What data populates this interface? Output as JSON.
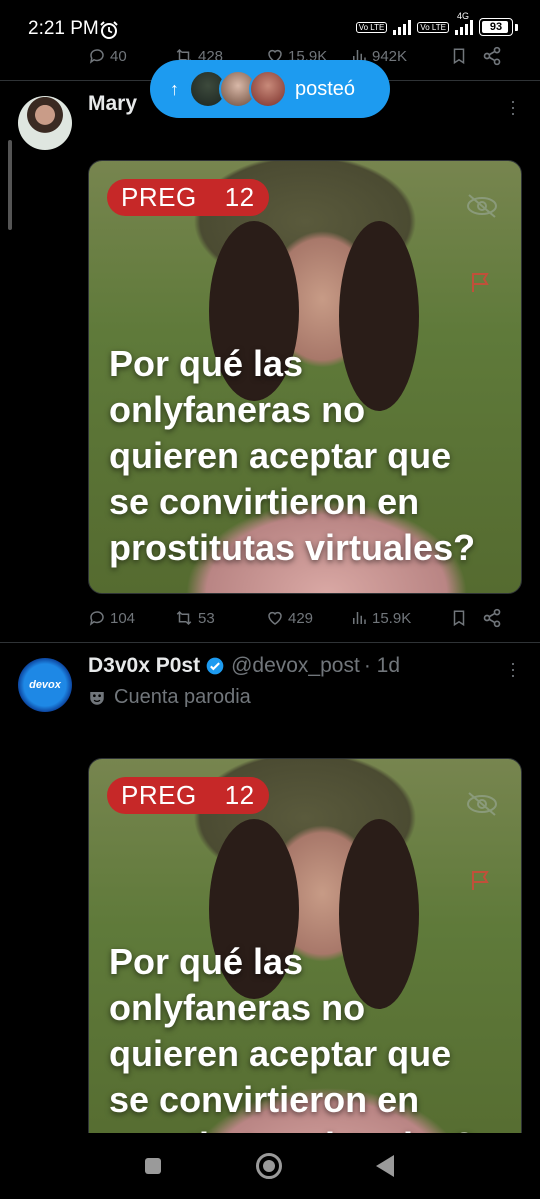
{
  "status_bar": {
    "time": "2:21 PM",
    "alarm_icon": "alarm-clock-icon",
    "network_label": "4G",
    "volte_label": "Vo LTE",
    "battery": "93"
  },
  "top_actions": {
    "replies": "40",
    "retweets": "428",
    "likes": "15.9K",
    "views": "942K"
  },
  "new_posts_pill": {
    "label": "posteó",
    "arrow": "↑"
  },
  "tweet1": {
    "name": "Mary",
    "media": {
      "badge_left": "PREG",
      "badge_right": "12",
      "headline": "Por qué las\nonlyfaneras no\nquieren aceptar que\nse convirtieron en\nprostitutas virtuales?"
    },
    "actions": {
      "replies": "104",
      "retweets": "53",
      "likes": "429",
      "views": "15.9K"
    }
  },
  "tweet2": {
    "name": "D3v0x P0st",
    "handle": "@devox_post",
    "time": "· 1d",
    "parody_label": "Cuenta parodia",
    "avatar_text": "devox",
    "media": {
      "badge_left": "PREG",
      "badge_right": "12",
      "headline": "Por qué las\nonlyfaneras no\nquieren aceptar que\nse convirtieron en\nprostitutas virtuales?"
    }
  },
  "colors": {
    "accent": "#1d9bf0",
    "badge": "#c62828",
    "muted": "#71767b",
    "background": "#000000"
  }
}
